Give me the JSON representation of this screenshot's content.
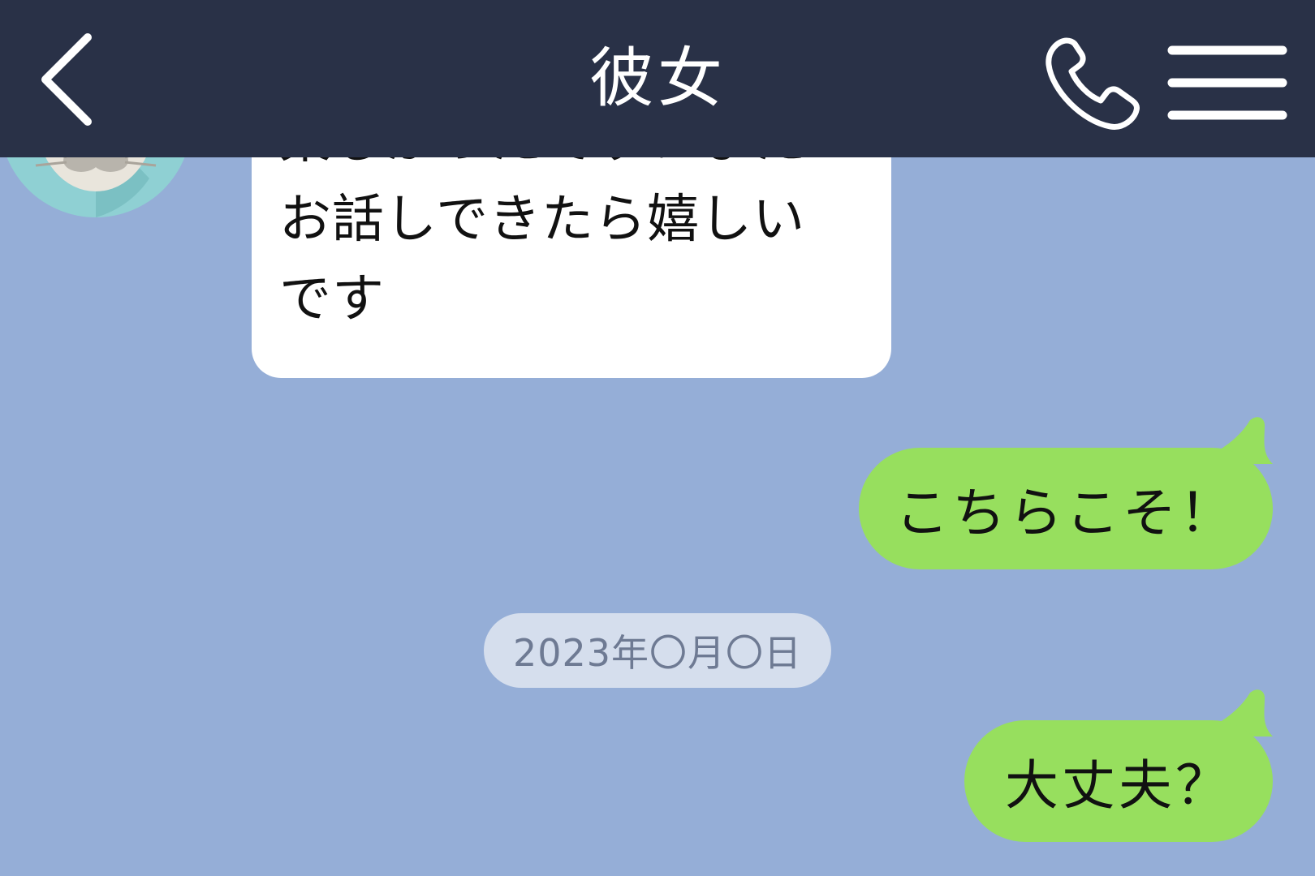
{
  "header": {
    "title": "彼女",
    "back_icon": "chevron-left-icon",
    "call_icon": "phone-icon",
    "menu_icon": "hamburger-menu-icon"
  },
  "messages": {
    "received": {
      "text": "楽しかったです！また\nお話しできたら嬉しい\nです"
    },
    "sent_1": {
      "text": "こちらこそ！"
    },
    "sent_2": {
      "text": "大丈夫？"
    }
  },
  "date_separator": {
    "text": "2023年〇月〇日"
  },
  "colors": {
    "header_bg": "#293147",
    "chat_bg": "#95aed7",
    "sent_bubble": "#97df5e",
    "received_bubble": "#ffffff",
    "date_badge_bg": "#d5deed",
    "date_badge_text": "#6e7a93"
  }
}
